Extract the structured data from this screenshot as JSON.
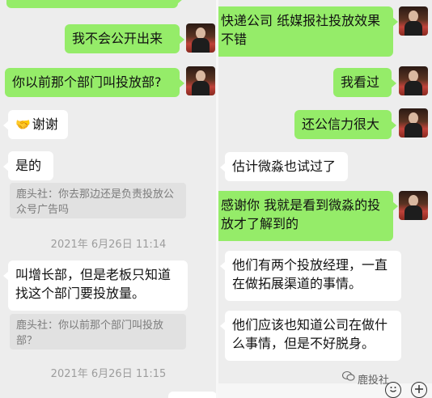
{
  "left": {
    "messages": [
      {
        "text": "我不会公开出来"
      },
      {
        "text": "你以前那个部门叫投放部?"
      },
      {
        "text": "谢谢"
      },
      {
        "text": "是的"
      },
      {
        "quote": "鹿头社：你去那边还是负责投放公众号广告吗"
      },
      {
        "timestamp": "2021年 6月26日 11:14"
      },
      {
        "text": "叫增长部，但是老板只知道找这个部门要投放量。"
      },
      {
        "quote": "鹿头社：你以前那个部门叫投放部？"
      },
      {
        "timestamp": "2021年 6月26日 11:15"
      }
    ]
  },
  "right": {
    "messages": [
      {
        "text": "快递公司 纸媒报社投放效果不错"
      },
      {
        "text": "我看过"
      },
      {
        "text": "还公信力很大"
      },
      {
        "text": "估计微淼也试过了"
      },
      {
        "text": "感谢你 我就是看到微淼的投放才了解到的"
      },
      {
        "text": "他们有两个投放经理，一直在做拓展渠道的事情。"
      },
      {
        "text": "他们应该也知道公司在做什么事情，但是不好脱身。"
      }
    ],
    "watermark": "鹿投社"
  },
  "colors": {
    "sent": "#95ec69",
    "received": "#ffffff",
    "background": "#ededed"
  },
  "icons": [
    "handshake-emoji",
    "emoji-icon",
    "plus-icon",
    "wechat-logo-icon"
  ]
}
